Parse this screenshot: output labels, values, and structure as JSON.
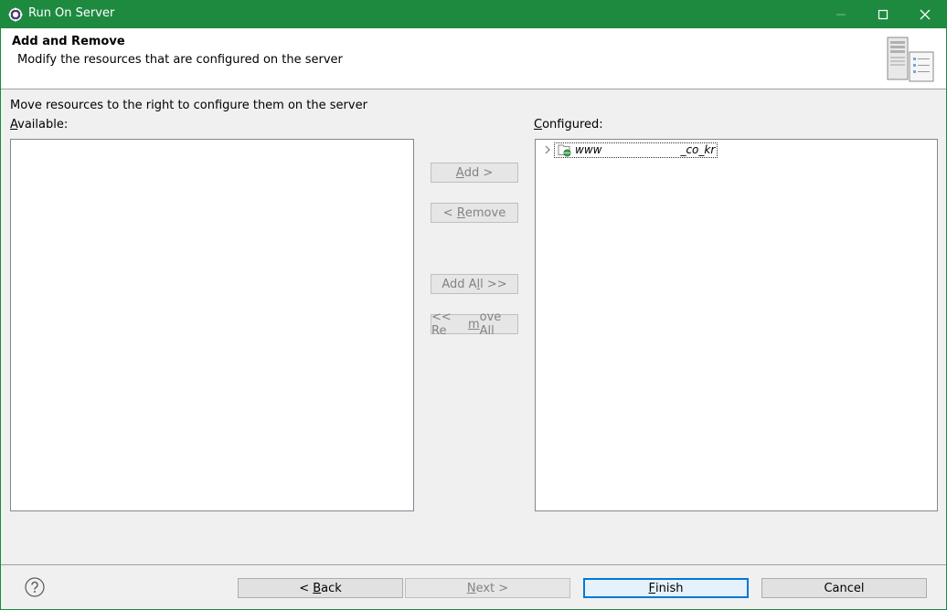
{
  "window": {
    "title": "Run On Server"
  },
  "header": {
    "title": "Add and Remove",
    "description": "Modify the resources that are configured on the server",
    "icon": "server-icon"
  },
  "content": {
    "instruction": "Move resources to the right to configure them on the server",
    "available_label": {
      "mnemonic": "A",
      "rest": "vailable:"
    },
    "configured_label": {
      "mnemonic": "C",
      "rest": "onfigured:"
    },
    "available_items": [],
    "configured_items": [
      {
        "name_start": "www",
        "name_end": "_co_kr",
        "icon": "web-project-icon",
        "expanded": false
      }
    ]
  },
  "middle_buttons": {
    "add": {
      "pre": "",
      "mnemonic": "A",
      "post": "dd >"
    },
    "remove": {
      "pre": "< ",
      "mnemonic": "R",
      "post": "emove"
    },
    "add_all": {
      "pre": "Add A",
      "mnemonic": "l",
      "post": "l >>"
    },
    "remove_all": {
      "pre": "<< Re",
      "mnemonic": "m",
      "post": "ove All"
    }
  },
  "footer": {
    "back": {
      "pre": "< ",
      "mnemonic": "B",
      "post": "ack"
    },
    "next": {
      "pre": "",
      "mnemonic": "N",
      "post": "ext >"
    },
    "finish": {
      "pre": "",
      "mnemonic": "F",
      "post": "inish"
    },
    "cancel": "Cancel"
  },
  "colors": {
    "titlebar": "#1e8a40",
    "default_button_border": "#0078d7",
    "disabled_text": "#838383"
  }
}
